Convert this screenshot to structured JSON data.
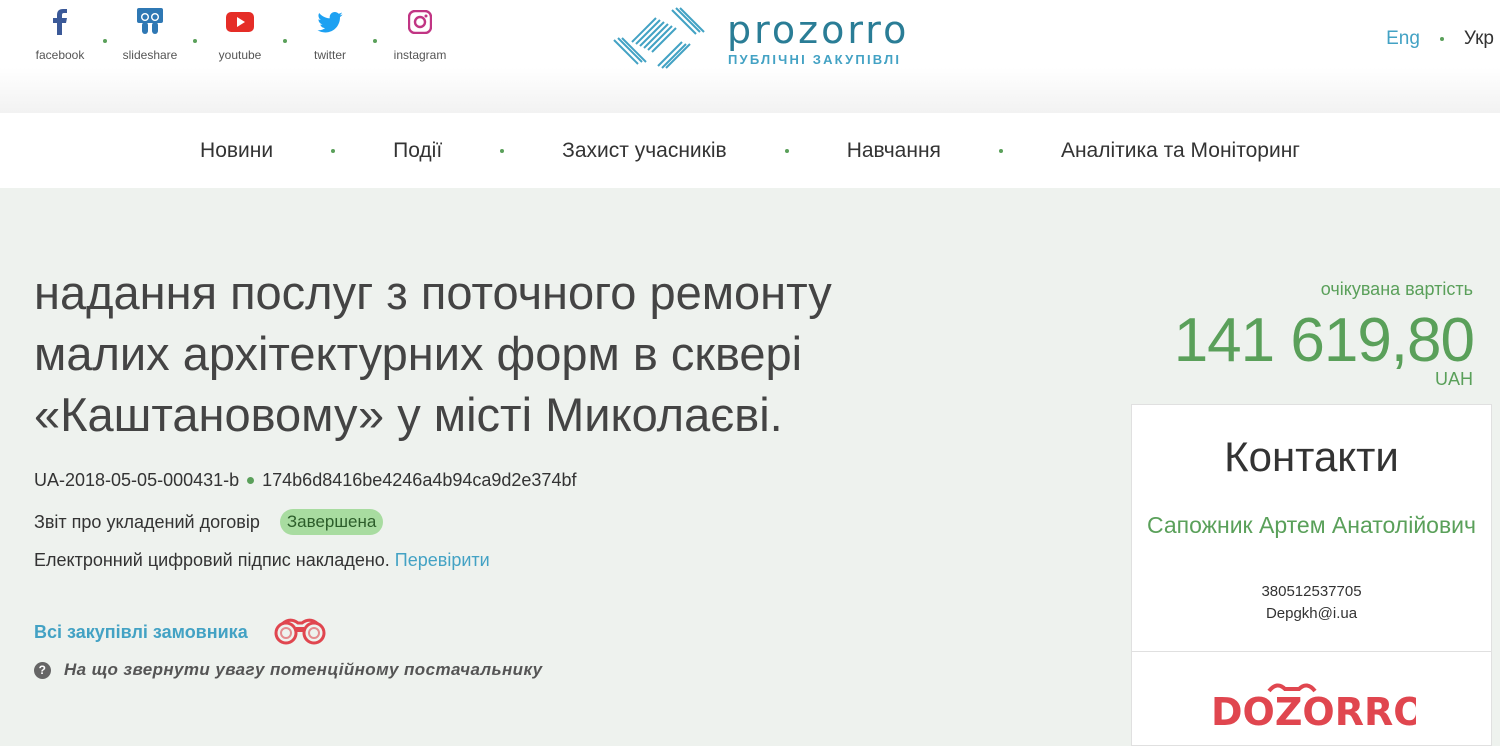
{
  "socials": [
    {
      "label": "facebook",
      "icon": "facebook-icon",
      "color": "#3b5998"
    },
    {
      "label": "slideshare",
      "icon": "slideshare-icon",
      "color": "#2f78b4"
    },
    {
      "label": "youtube",
      "icon": "youtube-icon",
      "color": "#e52d27"
    },
    {
      "label": "twitter",
      "icon": "twitter-icon",
      "color": "#1da1f2"
    },
    {
      "label": "instagram",
      "icon": "instagram-icon",
      "color": "#c13584"
    }
  ],
  "logo": {
    "word": "prozorro",
    "sub": "ПУБЛІЧНІ ЗАКУПІВЛІ"
  },
  "lang": {
    "eng": "Eng",
    "ukr": "Укр"
  },
  "nav": [
    "Новини",
    "Події",
    "Захист учасників",
    "Навчання",
    "Аналітика та Моніторинг"
  ],
  "tender": {
    "title": "надання послуг з поточного ремонту малих архітектурних форм в сквері «Каштановому» у місті Миколаєві.",
    "id": "UA-2018-05-05-000431-b",
    "hash": "174b6d8416be4246a4b94ca9d2e374bf",
    "report": "Звіт про укладений договір",
    "status": "Завершена",
    "sign_text": "Електронний цифровий підпис накладено.",
    "sign_link": "Перевірити",
    "all_buyer": "Всі закупівлі замовника",
    "attention": "На що звернути увагу потенційному постачальнику"
  },
  "value": {
    "label": "очікувана вартість",
    "amount": "141 619,80",
    "currency": "UAH"
  },
  "contacts": {
    "heading": "Контакти",
    "name": "Сапожник Артем Анатолійович",
    "phone": "380512537705",
    "email": "Depgkh@i.ua",
    "dozorro": "DOZORRO"
  },
  "colors": {
    "accent_green": "#5aa05a",
    "link_blue": "#43a2c4",
    "dozorro_red": "#e0464f"
  }
}
